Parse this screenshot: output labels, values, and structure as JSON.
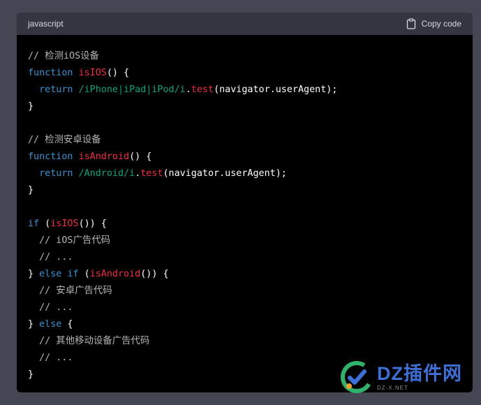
{
  "header": {
    "language": "javascript",
    "copy_label": "Copy code"
  },
  "code": {
    "lines": [
      [
        [
          "comment",
          "// 检测iOS设备"
        ]
      ],
      [
        [
          "keyword",
          "function"
        ],
        [
          "plain",
          " "
        ],
        [
          "func",
          "isIOS"
        ],
        [
          "plain",
          "() {"
        ]
      ],
      [
        [
          "plain",
          "  "
        ],
        [
          "keyword",
          "return"
        ],
        [
          "plain",
          " "
        ],
        [
          "regex",
          "/iPhone|iPad|iPod/i"
        ],
        [
          "plain",
          "."
        ],
        [
          "func",
          "test"
        ],
        [
          "plain",
          "(navigator.userAgent);"
        ]
      ],
      [
        [
          "plain",
          "}"
        ]
      ],
      [],
      [
        [
          "comment",
          "// 检测安卓设备"
        ]
      ],
      [
        [
          "keyword",
          "function"
        ],
        [
          "plain",
          " "
        ],
        [
          "func",
          "isAndroid"
        ],
        [
          "plain",
          "() {"
        ]
      ],
      [
        [
          "plain",
          "  "
        ],
        [
          "keyword",
          "return"
        ],
        [
          "plain",
          " "
        ],
        [
          "regex",
          "/Android/i"
        ],
        [
          "plain",
          "."
        ],
        [
          "func",
          "test"
        ],
        [
          "plain",
          "(navigator.userAgent);"
        ]
      ],
      [
        [
          "plain",
          "}"
        ]
      ],
      [],
      [
        [
          "keyword",
          "if"
        ],
        [
          "plain",
          " ("
        ],
        [
          "func",
          "isIOS"
        ],
        [
          "plain",
          "()) {"
        ]
      ],
      [
        [
          "plain",
          "  "
        ],
        [
          "comment",
          "// iOS广告代码"
        ]
      ],
      [
        [
          "plain",
          "  "
        ],
        [
          "comment",
          "// ..."
        ]
      ],
      [
        [
          "plain",
          "} "
        ],
        [
          "keyword",
          "else"
        ],
        [
          "plain",
          " "
        ],
        [
          "keyword",
          "if"
        ],
        [
          "plain",
          " ("
        ],
        [
          "func",
          "isAndroid"
        ],
        [
          "plain",
          "()) {"
        ]
      ],
      [
        [
          "plain",
          "  "
        ],
        [
          "comment",
          "// 安卓广告代码"
        ]
      ],
      [
        [
          "plain",
          "  "
        ],
        [
          "comment",
          "// ..."
        ]
      ],
      [
        [
          "plain",
          "} "
        ],
        [
          "keyword",
          "else"
        ],
        [
          "plain",
          " {"
        ]
      ],
      [
        [
          "plain",
          "  "
        ],
        [
          "comment",
          "// 其他移动设备广告代码"
        ]
      ],
      [
        [
          "plain",
          "  "
        ],
        [
          "comment",
          "// ..."
        ]
      ],
      [
        [
          "plain",
          "}"
        ]
      ]
    ]
  },
  "watermark": {
    "main": "DZ插件网",
    "sub": "DZ-X.NET"
  },
  "colors": {
    "background": "#444654",
    "code_bg": "#000000",
    "header_bg": "#343541",
    "keyword": "#2e95d3",
    "function": "#f22c3d",
    "regex": "#00a67d",
    "comment": "#b5b5b5"
  }
}
